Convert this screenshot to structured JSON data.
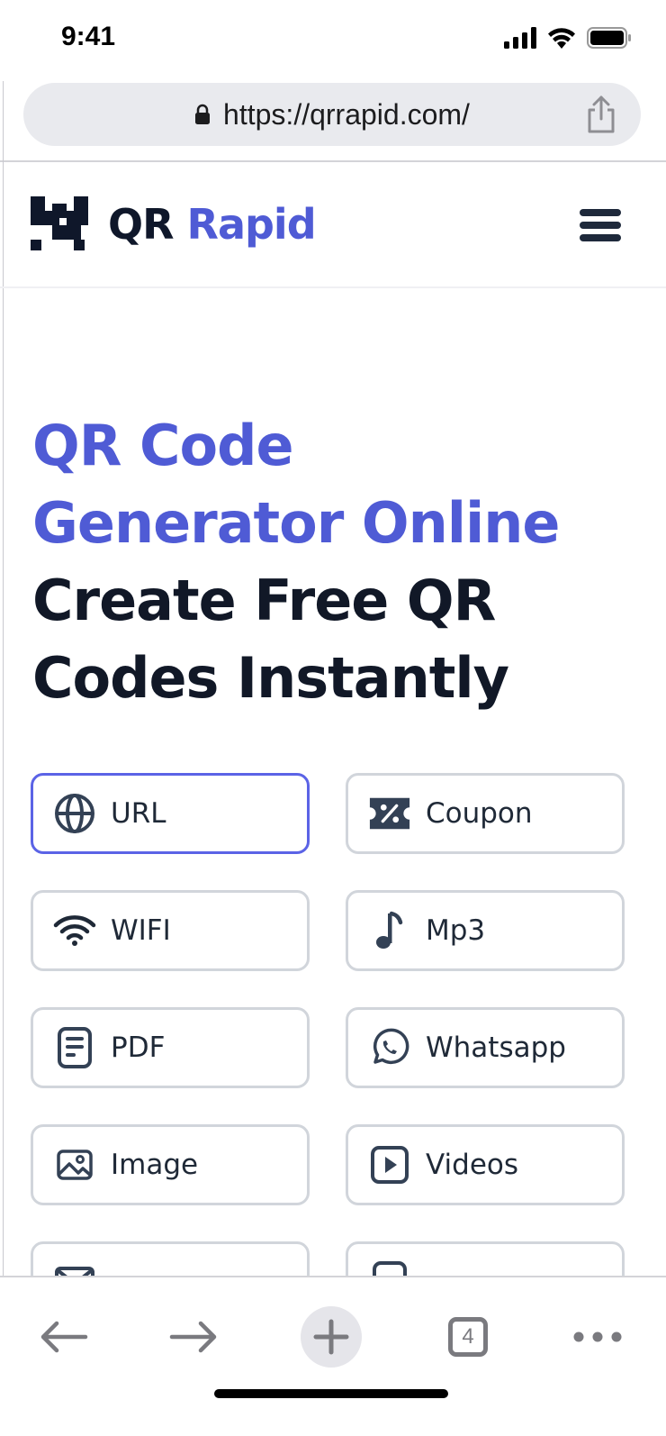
{
  "status_bar": {
    "time": "9:41"
  },
  "browser": {
    "url": "https://qrrapid.com/",
    "open_tabs": "4"
  },
  "site": {
    "logo_qr": "QR",
    "logo_rapid": "Rapid",
    "hero": {
      "line1": "QR Code",
      "line2": "Generator Online",
      "line3": "Create Free QR",
      "line4": "Codes Instantly"
    }
  },
  "qr_types": [
    {
      "label": "URL",
      "icon": "globe-icon",
      "selected": true
    },
    {
      "label": "Coupon",
      "icon": "coupon-icon",
      "selected": false
    },
    {
      "label": "WIFI",
      "icon": "wifi-icon",
      "selected": false
    },
    {
      "label": "Mp3",
      "icon": "music-note-icon",
      "selected": false
    },
    {
      "label": "PDF",
      "icon": "document-icon",
      "selected": false
    },
    {
      "label": "Whatsapp",
      "icon": "whatsapp-icon",
      "selected": false
    },
    {
      "label": "Image",
      "icon": "image-icon",
      "selected": false
    },
    {
      "label": "Videos",
      "icon": "video-play-icon",
      "selected": false
    }
  ],
  "colors": {
    "brand_blue": "#4f5bd5",
    "active_border": "#5b63e6",
    "dark_text": "#111827",
    "tile_border": "#d1d5db"
  }
}
